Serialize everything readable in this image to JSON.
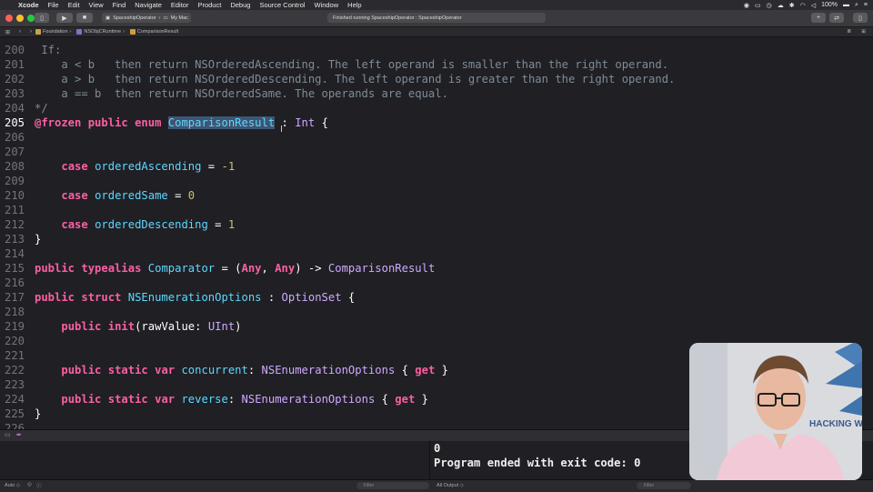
{
  "menubar": {
    "app": "Xcode",
    "items": [
      "File",
      "Edit",
      "View",
      "Find",
      "Navigate",
      "Editor",
      "Product",
      "Debug",
      "Source Control",
      "Window",
      "Help"
    ],
    "battery": "100%"
  },
  "toolbar": {
    "scheme": "SpaceshipOperator",
    "destination": "My Mac",
    "activity": "Finished running SpaceshipOperator : SpaceshipOperator"
  },
  "jumpbar": {
    "crumbs": [
      "Foundation",
      "NSObjCRuntime",
      "ComparisonResult"
    ]
  },
  "code_lines": [
    {
      "n": "200",
      "parts": [
        {
          "c": "cm",
          "t": " If:"
        }
      ]
    },
    {
      "n": "201",
      "parts": [
        {
          "c": "cm",
          "t": "    a < b   then return NSOrderedAscending. The left operand is smaller than the right operand."
        }
      ]
    },
    {
      "n": "202",
      "parts": [
        {
          "c": "cm",
          "t": "    a > b   then return NSOrderedDescending. The left operand is greater than the right operand."
        }
      ]
    },
    {
      "n": "203",
      "parts": [
        {
          "c": "cm",
          "t": "    a == b  then return NSOrderedSame. The operands are equal."
        }
      ]
    },
    {
      "n": "204",
      "parts": [
        {
          "c": "cm",
          "t": "*/"
        }
      ]
    },
    {
      "n": "205",
      "current": true,
      "parts": [
        {
          "c": "kw",
          "t": "@frozen"
        },
        {
          "c": "pln",
          "t": " "
        },
        {
          "c": "kw",
          "t": "public"
        },
        {
          "c": "pln",
          "t": " "
        },
        {
          "c": "kw",
          "t": "enum"
        },
        {
          "c": "pln",
          "t": " "
        },
        {
          "c": "hl",
          "t": "ComparisonResult"
        },
        {
          "c": "pln",
          "t": " : "
        },
        {
          "c": "typ",
          "t": "Int"
        },
        {
          "c": "pln",
          "t": " {"
        }
      ]
    },
    {
      "n": "206",
      "parts": []
    },
    {
      "n": "207",
      "parts": []
    },
    {
      "n": "208",
      "parts": [
        {
          "c": "pln",
          "t": "    "
        },
        {
          "c": "kw",
          "t": "case"
        },
        {
          "c": "pln",
          "t": " "
        },
        {
          "c": "prj",
          "t": "orderedAscending"
        },
        {
          "c": "pln",
          "t": " = "
        },
        {
          "c": "num",
          "t": "-1"
        }
      ]
    },
    {
      "n": "209",
      "parts": []
    },
    {
      "n": "210",
      "parts": [
        {
          "c": "pln",
          "t": "    "
        },
        {
          "c": "kw",
          "t": "case"
        },
        {
          "c": "pln",
          "t": " "
        },
        {
          "c": "prj",
          "t": "orderedSame"
        },
        {
          "c": "pln",
          "t": " = "
        },
        {
          "c": "num",
          "t": "0"
        }
      ]
    },
    {
      "n": "211",
      "parts": []
    },
    {
      "n": "212",
      "parts": [
        {
          "c": "pln",
          "t": "    "
        },
        {
          "c": "kw",
          "t": "case"
        },
        {
          "c": "pln",
          "t": " "
        },
        {
          "c": "prj",
          "t": "orderedDescending"
        },
        {
          "c": "pln",
          "t": " = "
        },
        {
          "c": "num",
          "t": "1"
        }
      ]
    },
    {
      "n": "213",
      "parts": [
        {
          "c": "pln",
          "t": "}"
        }
      ]
    },
    {
      "n": "214",
      "parts": []
    },
    {
      "n": "215",
      "parts": [
        {
          "c": "kw",
          "t": "public"
        },
        {
          "c": "pln",
          "t": " "
        },
        {
          "c": "kw",
          "t": "typealias"
        },
        {
          "c": "pln",
          "t": " "
        },
        {
          "c": "prj",
          "t": "Comparator"
        },
        {
          "c": "pln",
          "t": " = ("
        },
        {
          "c": "kw",
          "t": "Any"
        },
        {
          "c": "pln",
          "t": ", "
        },
        {
          "c": "kw",
          "t": "Any"
        },
        {
          "c": "pln",
          "t": ") -> "
        },
        {
          "c": "typ",
          "t": "ComparisonResult"
        }
      ]
    },
    {
      "n": "216",
      "parts": []
    },
    {
      "n": "217",
      "parts": [
        {
          "c": "kw",
          "t": "public"
        },
        {
          "c": "pln",
          "t": " "
        },
        {
          "c": "kw",
          "t": "struct"
        },
        {
          "c": "pln",
          "t": " "
        },
        {
          "c": "prj",
          "t": "NSEnumerationOptions"
        },
        {
          "c": "pln",
          "t": " : "
        },
        {
          "c": "typ",
          "t": "OptionSet"
        },
        {
          "c": "pln",
          "t": " {"
        }
      ]
    },
    {
      "n": "218",
      "parts": []
    },
    {
      "n": "219",
      "parts": [
        {
          "c": "pln",
          "t": "    "
        },
        {
          "c": "kw",
          "t": "public"
        },
        {
          "c": "pln",
          "t": " "
        },
        {
          "c": "kw",
          "t": "init"
        },
        {
          "c": "pln",
          "t": "(rawValue: "
        },
        {
          "c": "typ",
          "t": "UInt"
        },
        {
          "c": "pln",
          "t": ")"
        }
      ]
    },
    {
      "n": "220",
      "parts": []
    },
    {
      "n": "221",
      "parts": []
    },
    {
      "n": "222",
      "parts": [
        {
          "c": "pln",
          "t": "    "
        },
        {
          "c": "kw",
          "t": "public"
        },
        {
          "c": "pln",
          "t": " "
        },
        {
          "c": "kw",
          "t": "static"
        },
        {
          "c": "pln",
          "t": " "
        },
        {
          "c": "kw",
          "t": "var"
        },
        {
          "c": "pln",
          "t": " "
        },
        {
          "c": "prj",
          "t": "concurrent"
        },
        {
          "c": "pln",
          "t": ": "
        },
        {
          "c": "typ",
          "t": "NSEnumerationOptions"
        },
        {
          "c": "pln",
          "t": " { "
        },
        {
          "c": "kw",
          "t": "get"
        },
        {
          "c": "pln",
          "t": " }"
        }
      ]
    },
    {
      "n": "223",
      "parts": []
    },
    {
      "n": "224",
      "parts": [
        {
          "c": "pln",
          "t": "    "
        },
        {
          "c": "kw",
          "t": "public"
        },
        {
          "c": "pln",
          "t": " "
        },
        {
          "c": "kw",
          "t": "static"
        },
        {
          "c": "pln",
          "t": " "
        },
        {
          "c": "kw",
          "t": "var"
        },
        {
          "c": "pln",
          "t": " "
        },
        {
          "c": "prj",
          "t": "reverse"
        },
        {
          "c": "pln",
          "t": ": "
        },
        {
          "c": "typ",
          "t": "NSEnumerationOptions"
        },
        {
          "c": "pln",
          "t": " { "
        },
        {
          "c": "kw",
          "t": "get"
        },
        {
          "c": "pln",
          "t": " }"
        }
      ]
    },
    {
      "n": "225",
      "parts": [
        {
          "c": "pln",
          "t": "}"
        }
      ]
    },
    {
      "n": "226",
      "parts": []
    }
  ],
  "console": {
    "lines": [
      "0",
      "Program ended with exit code: 0"
    ]
  },
  "bottombar": {
    "auto_label": "Auto ◇",
    "filter_left": "Filter",
    "output_label": "All Output ◇",
    "filter_right": "Filter"
  },
  "webcam": {
    "banner_text": "HACKING W"
  },
  "colors": {
    "keyword": "#fc5fa3",
    "number": "#d0bf69",
    "type": "#d0a8ff",
    "project": "#5dd8ff",
    "comment": "#7f8c98",
    "background": "#1f1f24"
  }
}
